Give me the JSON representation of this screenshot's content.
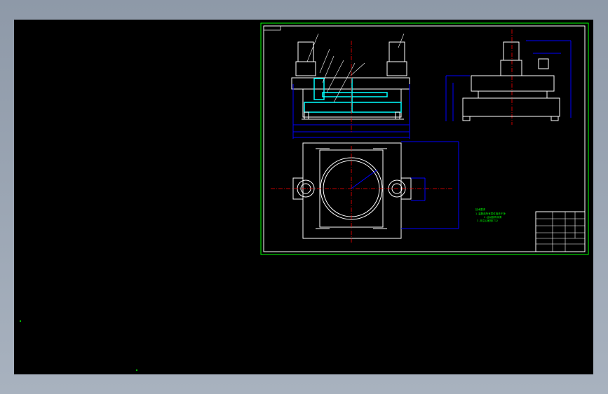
{
  "app": {
    "colors": {
      "background": "#000000",
      "frame_border": "#00ff00",
      "geometry": "#ffffff",
      "dimension": "#0000ff",
      "centerline": "#ff0000",
      "highlight": "#00ffff",
      "note_text": "#00ff00"
    }
  },
  "drawing": {
    "title_block": {
      "rows": [
        "",
        "",
        "",
        "",
        "",
        ""
      ]
    },
    "notes": [
      "技术要求",
      "1.装配前所有零件清洗干净",
      "2.运动部件润滑",
      "3.未注公差按IT12"
    ]
  }
}
